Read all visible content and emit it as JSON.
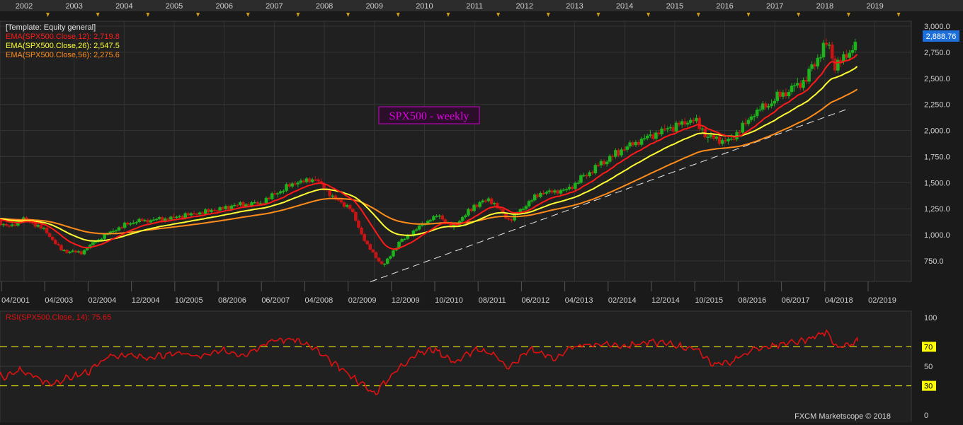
{
  "top_axis_years": [
    "2002",
    "2003",
    "2004",
    "2005",
    "2006",
    "2007",
    "2008",
    "2009",
    "2010",
    "2011",
    "2012",
    "2013",
    "2014",
    "2015",
    "2016",
    "2017",
    "2018",
    "2019"
  ],
  "bottom_axis_dates": [
    "04/2001",
    "04/2003",
    "02/2004",
    "12/2004",
    "10/2005",
    "08/2006",
    "06/2007",
    "04/2008",
    "02/2009",
    "12/2009",
    "10/2010",
    "08/2011",
    "06/2012",
    "04/2013",
    "02/2014",
    "12/2014",
    "10/2015",
    "08/2016",
    "06/2017",
    "04/2018",
    "02/2019"
  ],
  "legend": {
    "template": "[Template: Equity general]",
    "ema12": "EMA(SPX500.Close,12): 2,719.8",
    "ema26": "EMA(SPX500.Close,26): 2,547.5",
    "ema56": "EMA(SPX500.Close,56): 2,275.6"
  },
  "title_box": "SPX500 - weekly",
  "price_axis": {
    "labels": [
      "3,000.0",
      "2,750.0",
      "2,500.0",
      "2,250.0",
      "2,000.0",
      "1,750.0",
      "1,500.0",
      "1,250.0",
      "1,000.0",
      "750.0"
    ],
    "last_price": "2,888.76"
  },
  "rsi": {
    "label": "RSI(SPX500.Close, 14): 75.65",
    "axis_labels": [
      "100",
      "70",
      "50",
      "30",
      "0"
    ]
  },
  "watermark": "FXCM Marketscope © 2018",
  "colors": {
    "bg": "#1a1a1a",
    "panel": "#202020",
    "up": "#1db31d",
    "down": "#c81414",
    "ema12": "#ff1a1a",
    "ema26": "#ffff33",
    "ema56": "#ff8c1a",
    "rsi": "#e01010",
    "level": "#ffff00",
    "accent": "#3399ff",
    "title": "#e000e0"
  },
  "chart_data": [
    {
      "type": "candlestick",
      "title": "SPX500 - weekly",
      "timeframe": "weekly",
      "x_range": [
        "2001-04",
        "2019-02"
      ],
      "ylim": [
        550,
        3050
      ],
      "trendline": [
        {
          "x": "2008-12",
          "y": 550
        },
        {
          "x": "2018-06",
          "y": 2200
        }
      ],
      "anchors": [
        {
          "t": 2001.3,
          "v": 1160
        },
        {
          "t": 2001.7,
          "v": 1080
        },
        {
          "t": 2002.0,
          "v": 1150
        },
        {
          "t": 2002.4,
          "v": 1050
        },
        {
          "t": 2002.75,
          "v": 850
        },
        {
          "t": 2003.15,
          "v": 830
        },
        {
          "t": 2003.4,
          "v": 930
        },
        {
          "t": 2003.8,
          "v": 1050
        },
        {
          "t": 2004.2,
          "v": 1130
        },
        {
          "t": 2004.8,
          "v": 1150
        },
        {
          "t": 2005.5,
          "v": 1210
        },
        {
          "t": 2006.3,
          "v": 1290
        },
        {
          "t": 2006.7,
          "v": 1300
        },
        {
          "t": 2007.4,
          "v": 1500
        },
        {
          "t": 2007.8,
          "v": 1540
        },
        {
          "t": 2008.2,
          "v": 1350
        },
        {
          "t": 2008.5,
          "v": 1270
        },
        {
          "t": 2008.85,
          "v": 900
        },
        {
          "t": 2009.17,
          "v": 700
        },
        {
          "t": 2009.5,
          "v": 930
        },
        {
          "t": 2010.0,
          "v": 1120
        },
        {
          "t": 2010.3,
          "v": 1190
        },
        {
          "t": 2010.55,
          "v": 1060
        },
        {
          "t": 2011.0,
          "v": 1280
        },
        {
          "t": 2011.3,
          "v": 1340
        },
        {
          "t": 2011.7,
          "v": 1140
        },
        {
          "t": 2012.3,
          "v": 1400
        },
        {
          "t": 2012.8,
          "v": 1420
        },
        {
          "t": 2013.4,
          "v": 1640
        },
        {
          "t": 2014.0,
          "v": 1830
        },
        {
          "t": 2014.6,
          "v": 1970
        },
        {
          "t": 2015.4,
          "v": 2110
        },
        {
          "t": 2015.65,
          "v": 1930
        },
        {
          "t": 2016.1,
          "v": 1900
        },
        {
          "t": 2016.6,
          "v": 2170
        },
        {
          "t": 2017.1,
          "v": 2330
        },
        {
          "t": 2017.6,
          "v": 2480
        },
        {
          "t": 2018.05,
          "v": 2850
        },
        {
          "t": 2018.2,
          "v": 2620
        },
        {
          "t": 2018.45,
          "v": 2720
        },
        {
          "t": 2018.65,
          "v": 2888.76
        }
      ],
      "series": [
        {
          "name": "EMA(SPX500.Close,12)",
          "last": 2719.8
        },
        {
          "name": "EMA(SPX500.Close,26)",
          "last": 2547.5
        },
        {
          "name": "EMA(SPX500.Close,56)",
          "last": 2275.6
        }
      ]
    },
    {
      "type": "line",
      "title": "RSI(SPX500.Close, 14)",
      "ylim": [
        0,
        100
      ],
      "levels": [
        70,
        50,
        30
      ],
      "last": 75.65,
      "points": [
        {
          "t": 2001.3,
          "v": 44
        },
        {
          "t": 2001.6,
          "v": 38
        },
        {
          "t": 2001.9,
          "v": 46
        },
        {
          "t": 2002.2,
          "v": 40
        },
        {
          "t": 2002.5,
          "v": 32
        },
        {
          "t": 2002.9,
          "v": 38
        },
        {
          "t": 2003.3,
          "v": 45
        },
        {
          "t": 2003.7,
          "v": 60
        },
        {
          "t": 2004.0,
          "v": 62
        },
        {
          "t": 2004.5,
          "v": 58
        },
        {
          "t": 2005.0,
          "v": 64
        },
        {
          "t": 2005.5,
          "v": 60
        },
        {
          "t": 2006.0,
          "v": 66
        },
        {
          "t": 2006.4,
          "v": 62
        },
        {
          "t": 2006.9,
          "v": 76
        },
        {
          "t": 2007.4,
          "v": 78
        },
        {
          "t": 2007.8,
          "v": 68
        },
        {
          "t": 2008.2,
          "v": 52
        },
        {
          "t": 2008.6,
          "v": 38
        },
        {
          "t": 2009.0,
          "v": 22
        },
        {
          "t": 2009.4,
          "v": 44
        },
        {
          "t": 2009.8,
          "v": 62
        },
        {
          "t": 2010.2,
          "v": 68
        },
        {
          "t": 2010.6,
          "v": 54
        },
        {
          "t": 2011.0,
          "v": 67
        },
        {
          "t": 2011.4,
          "v": 62
        },
        {
          "t": 2011.7,
          "v": 48
        },
        {
          "t": 2012.1,
          "v": 68
        },
        {
          "t": 2012.6,
          "v": 58
        },
        {
          "t": 2013.0,
          "v": 70
        },
        {
          "t": 2013.5,
          "v": 73
        },
        {
          "t": 2014.0,
          "v": 71
        },
        {
          "t": 2014.5,
          "v": 75
        },
        {
          "t": 2015.0,
          "v": 72
        },
        {
          "t": 2015.5,
          "v": 66
        },
        {
          "t": 2015.75,
          "v": 52
        },
        {
          "t": 2016.1,
          "v": 54
        },
        {
          "t": 2016.6,
          "v": 68
        },
        {
          "t": 2017.1,
          "v": 72
        },
        {
          "t": 2017.6,
          "v": 76
        },
        {
          "t": 2018.05,
          "v": 86
        },
        {
          "t": 2018.25,
          "v": 68
        },
        {
          "t": 2018.5,
          "v": 72
        },
        {
          "t": 2018.65,
          "v": 75.65
        }
      ]
    }
  ]
}
